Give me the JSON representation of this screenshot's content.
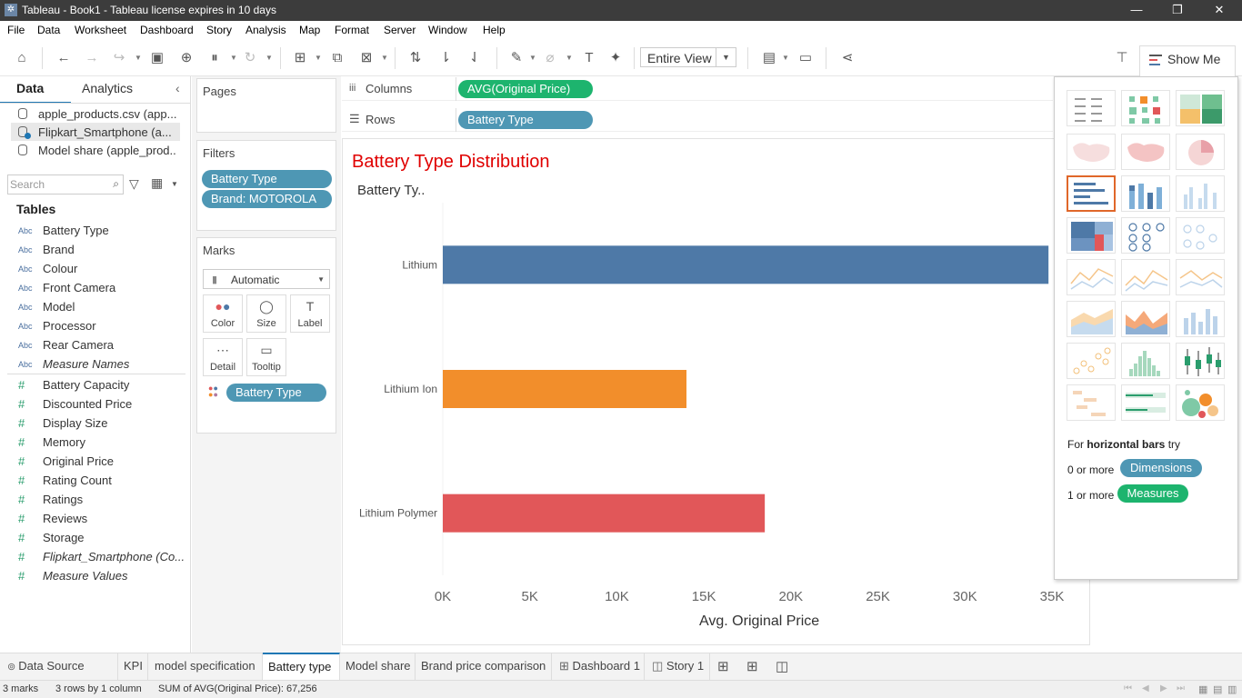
{
  "window": {
    "title": "Tableau - Book1 - Tableau license expires in 10 days"
  },
  "menu": [
    "File",
    "Data",
    "Worksheet",
    "Dashboard",
    "Story",
    "Analysis",
    "Map",
    "Format",
    "Server",
    "Window",
    "Help"
  ],
  "toolbar": {
    "view_select": "Entire View",
    "show_me_label": "Show Me"
  },
  "left_pane": {
    "tabs": {
      "data": "Data",
      "analytics": "Analytics"
    },
    "data_sources": [
      "apple_products.csv (app...",
      "Flipkart_Smartphone (a...",
      "Model share (apple_prod..."
    ],
    "search_placeholder": "Search",
    "tables_header": "Tables",
    "dimensions": [
      {
        "type": "Abc",
        "name": "Battery Type"
      },
      {
        "type": "Abc",
        "name": "Brand"
      },
      {
        "type": "Abc",
        "name": "Colour"
      },
      {
        "type": "Abc",
        "name": "Front Camera"
      },
      {
        "type": "Abc",
        "name": "Model"
      },
      {
        "type": "Abc",
        "name": "Processor"
      },
      {
        "type": "Abc",
        "name": "Rear Camera"
      },
      {
        "type": "Abc",
        "name": "Measure Names"
      }
    ],
    "measures": [
      {
        "type": "#",
        "name": "Battery Capacity"
      },
      {
        "type": "#",
        "name": "Discounted Price"
      },
      {
        "type": "#",
        "name": "Display Size"
      },
      {
        "type": "#",
        "name": "Memory"
      },
      {
        "type": "#",
        "name": "Original Price"
      },
      {
        "type": "#",
        "name": "Rating Count"
      },
      {
        "type": "#",
        "name": "Ratings"
      },
      {
        "type": "#",
        "name": "Reviews"
      },
      {
        "type": "#",
        "name": "Storage"
      },
      {
        "type": "#",
        "name": "Flipkart_Smartphone (Co..."
      },
      {
        "type": "#",
        "name": "Measure Values"
      }
    ]
  },
  "cards": {
    "pages": "Pages",
    "filters": "Filters",
    "filter_pills": [
      "Battery Type",
      "Brand: MOTOROLA"
    ],
    "marks": "Marks",
    "mark_type": "Automatic",
    "mark_buttons": [
      "Color",
      "Size",
      "Label",
      "Detail",
      "Tooltip"
    ],
    "mark_pill": "Battery Type"
  },
  "shelves": {
    "columns_label": "Columns",
    "columns_pill": "AVG(Original Price)",
    "rows_label": "Rows",
    "rows_pill": "Battery Type"
  },
  "chart_data": {
    "type": "bar",
    "orientation": "horizontal",
    "title": "Battery Type Distribution",
    "row_header": "Battery Ty..",
    "xlabel": "Avg. Original Price",
    "categories": [
      "Lithium",
      "Lithium Ion",
      "Lithium Polymer"
    ],
    "values": [
      34800,
      14000,
      18500
    ],
    "colors": [
      "#4e79a7",
      "#f28e2b",
      "#e15759"
    ],
    "xlim": [
      0,
      35000
    ],
    "xticks": [
      0,
      5000,
      10000,
      15000,
      20000,
      25000,
      30000,
      35000
    ],
    "xtick_labels": [
      "0K",
      "5K",
      "10K",
      "15K",
      "20K",
      "25K",
      "30K",
      "35K"
    ],
    "title_color": "#e00000"
  },
  "show_me": {
    "hint_prefix": "For",
    "hint_bold": "horizontal bars",
    "hint_suffix": "try",
    "req1_prefix": "0 or more",
    "req1_pill": "Dimensions",
    "req2_prefix": "1 or more",
    "req2_pill": "Measures"
  },
  "sheet_tabs": [
    "Data Source",
    "KPI",
    "model specification",
    "Battery type",
    "Model share",
    "Brand price comparison",
    "Dashboard 1",
    "Story 1"
  ],
  "status": {
    "marks": "3 marks",
    "rows": "3 rows by 1 column",
    "sum": "SUM of AVG(Original Price): 67,256"
  }
}
